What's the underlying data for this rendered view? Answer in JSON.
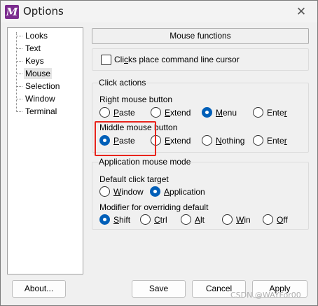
{
  "window": {
    "title": "Options",
    "icon_letter": "M",
    "close_glyph": "✕"
  },
  "tree": {
    "items": [
      {
        "label": "Looks",
        "selected": false
      },
      {
        "label": "Text",
        "selected": false
      },
      {
        "label": "Keys",
        "selected": false
      },
      {
        "label": "Mouse",
        "selected": true
      },
      {
        "label": "Selection",
        "selected": false
      },
      {
        "label": "Window",
        "selected": false
      },
      {
        "label": "Terminal",
        "selected": false
      }
    ]
  },
  "panel": {
    "title": "Mouse functions",
    "clicks_place_cursor": {
      "label_pre": "Cli",
      "label_u": "c",
      "label_post": "ks place command line cursor",
      "checked": false
    },
    "click_actions": {
      "label": "Click actions",
      "right_button": {
        "label": "Right mouse button",
        "options": [
          {
            "pre": "",
            "u": "P",
            "post": "aste",
            "selected": false
          },
          {
            "pre": "",
            "u": "E",
            "post": "xtend",
            "selected": false
          },
          {
            "pre": "",
            "u": "M",
            "post": "enu",
            "selected": true
          },
          {
            "pre": "Ente",
            "u": "r",
            "post": "",
            "selected": false
          }
        ]
      },
      "middle_button": {
        "label": "Middle mouse button",
        "options": [
          {
            "pre": "",
            "u": "P",
            "post": "aste",
            "selected": true
          },
          {
            "pre": "",
            "u": "E",
            "post": "xtend",
            "selected": false
          },
          {
            "pre": "",
            "u": "N",
            "post": "othing",
            "selected": false
          },
          {
            "pre": "Ente",
            "u": "r",
            "post": "",
            "selected": false
          }
        ]
      }
    },
    "app_mouse_mode": {
      "label": "Application mouse mode",
      "default_target": {
        "label": "Default click target",
        "options": [
          {
            "pre": "",
            "u": "W",
            "post": "indow",
            "selected": false
          },
          {
            "pre": "",
            "u": "A",
            "post": "pplication",
            "selected": true
          }
        ]
      },
      "modifier": {
        "label": "Modifier for overriding default",
        "options": [
          {
            "pre": "",
            "u": "S",
            "post": "hift",
            "selected": true
          },
          {
            "pre": "",
            "u": "C",
            "post": "trl",
            "selected": false
          },
          {
            "pre": "",
            "u": "A",
            "post": "lt",
            "selected": false
          },
          {
            "pre": "",
            "u": "W",
            "post": "in",
            "selected": false
          },
          {
            "pre": "",
            "u": "O",
            "post": "ff",
            "selected": false
          }
        ]
      }
    }
  },
  "buttons": {
    "about": "About...",
    "save": "Save",
    "cancel": "Cancel",
    "apply": "Apply"
  },
  "watermark": "CSDN @WAYFor00",
  "colors": {
    "accent": "#005fb8",
    "highlight": "#e8241c",
    "app_icon": "#7b2b8e"
  }
}
